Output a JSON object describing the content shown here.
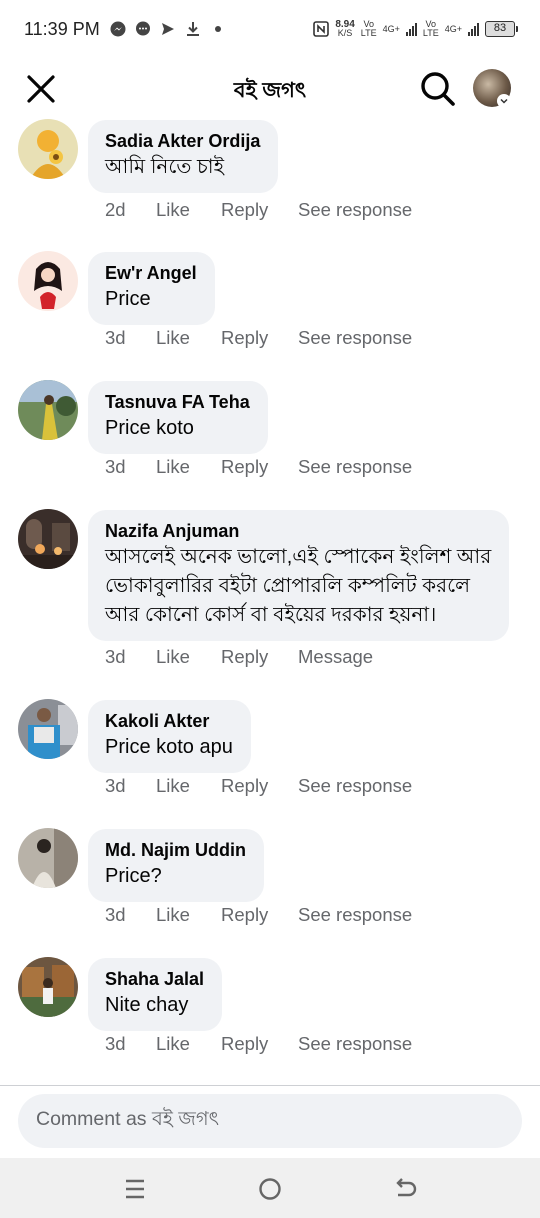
{
  "status_bar": {
    "time": "11:39 PM",
    "net_speed_value": "8.94",
    "net_speed_unit": "K/S",
    "sim1_label_top": "Vo",
    "sim1_label_bottom": "LTE",
    "sim1_network": "4G+",
    "sim2_label_top": "Vo",
    "sim2_label_bottom": "LTE",
    "sim2_network": "4G+",
    "battery": "83"
  },
  "header": {
    "title": "বই জগৎ"
  },
  "comments": [
    {
      "author": "Sadia Akter Ordija",
      "text": "আমি নিতে চাই",
      "time": "2d",
      "like": "Like",
      "reply": "Reply",
      "extra": "See response"
    },
    {
      "author": "Ew'r Angel",
      "text": "Price",
      "time": "3d",
      "like": "Like",
      "reply": "Reply",
      "extra": "See response"
    },
    {
      "author": "Tasnuva FA Teha",
      "text": "Price koto",
      "time": "3d",
      "like": "Like",
      "reply": "Reply",
      "extra": "See response"
    },
    {
      "author": "Nazifa Anjuman",
      "text_lines": [
        "আসলেই অনেক ভালো,এই স্পোকেন ইংলিশ আর",
        "ভোকাবুলারির বইটা প্রোপারলি কম্পলিট করলে",
        "আর কোনো কোর্স বা বইয়ের দরকার হয়না।"
      ],
      "time": "3d",
      "like": "Like",
      "reply": "Reply",
      "extra": "Message"
    },
    {
      "author": "Kakoli Akter",
      "text": "Price koto apu",
      "time": "3d",
      "like": "Like",
      "reply": "Reply",
      "extra": "See response"
    },
    {
      "author": "Md. Najim Uddin",
      "text": "Price?",
      "time": "3d",
      "like": "Like",
      "reply": "Reply",
      "extra": "See response"
    },
    {
      "author": "Shaha Jalal",
      "text": "Nite chay",
      "time": "3d",
      "like": "Like",
      "reply": "Reply",
      "extra": "See response"
    }
  ],
  "composer": {
    "placeholder": "Comment as বই জগৎ"
  },
  "icons": [
    "messenger-icon",
    "chat-icon",
    "send-icon",
    "download-icon",
    "nfc-icon",
    "close-icon",
    "search-icon",
    "menu-icon",
    "home-icon",
    "back-icon"
  ],
  "colors": {
    "bubble": "#f0f2f5",
    "secondary_text": "#65676b",
    "primary_text": "#050505"
  }
}
